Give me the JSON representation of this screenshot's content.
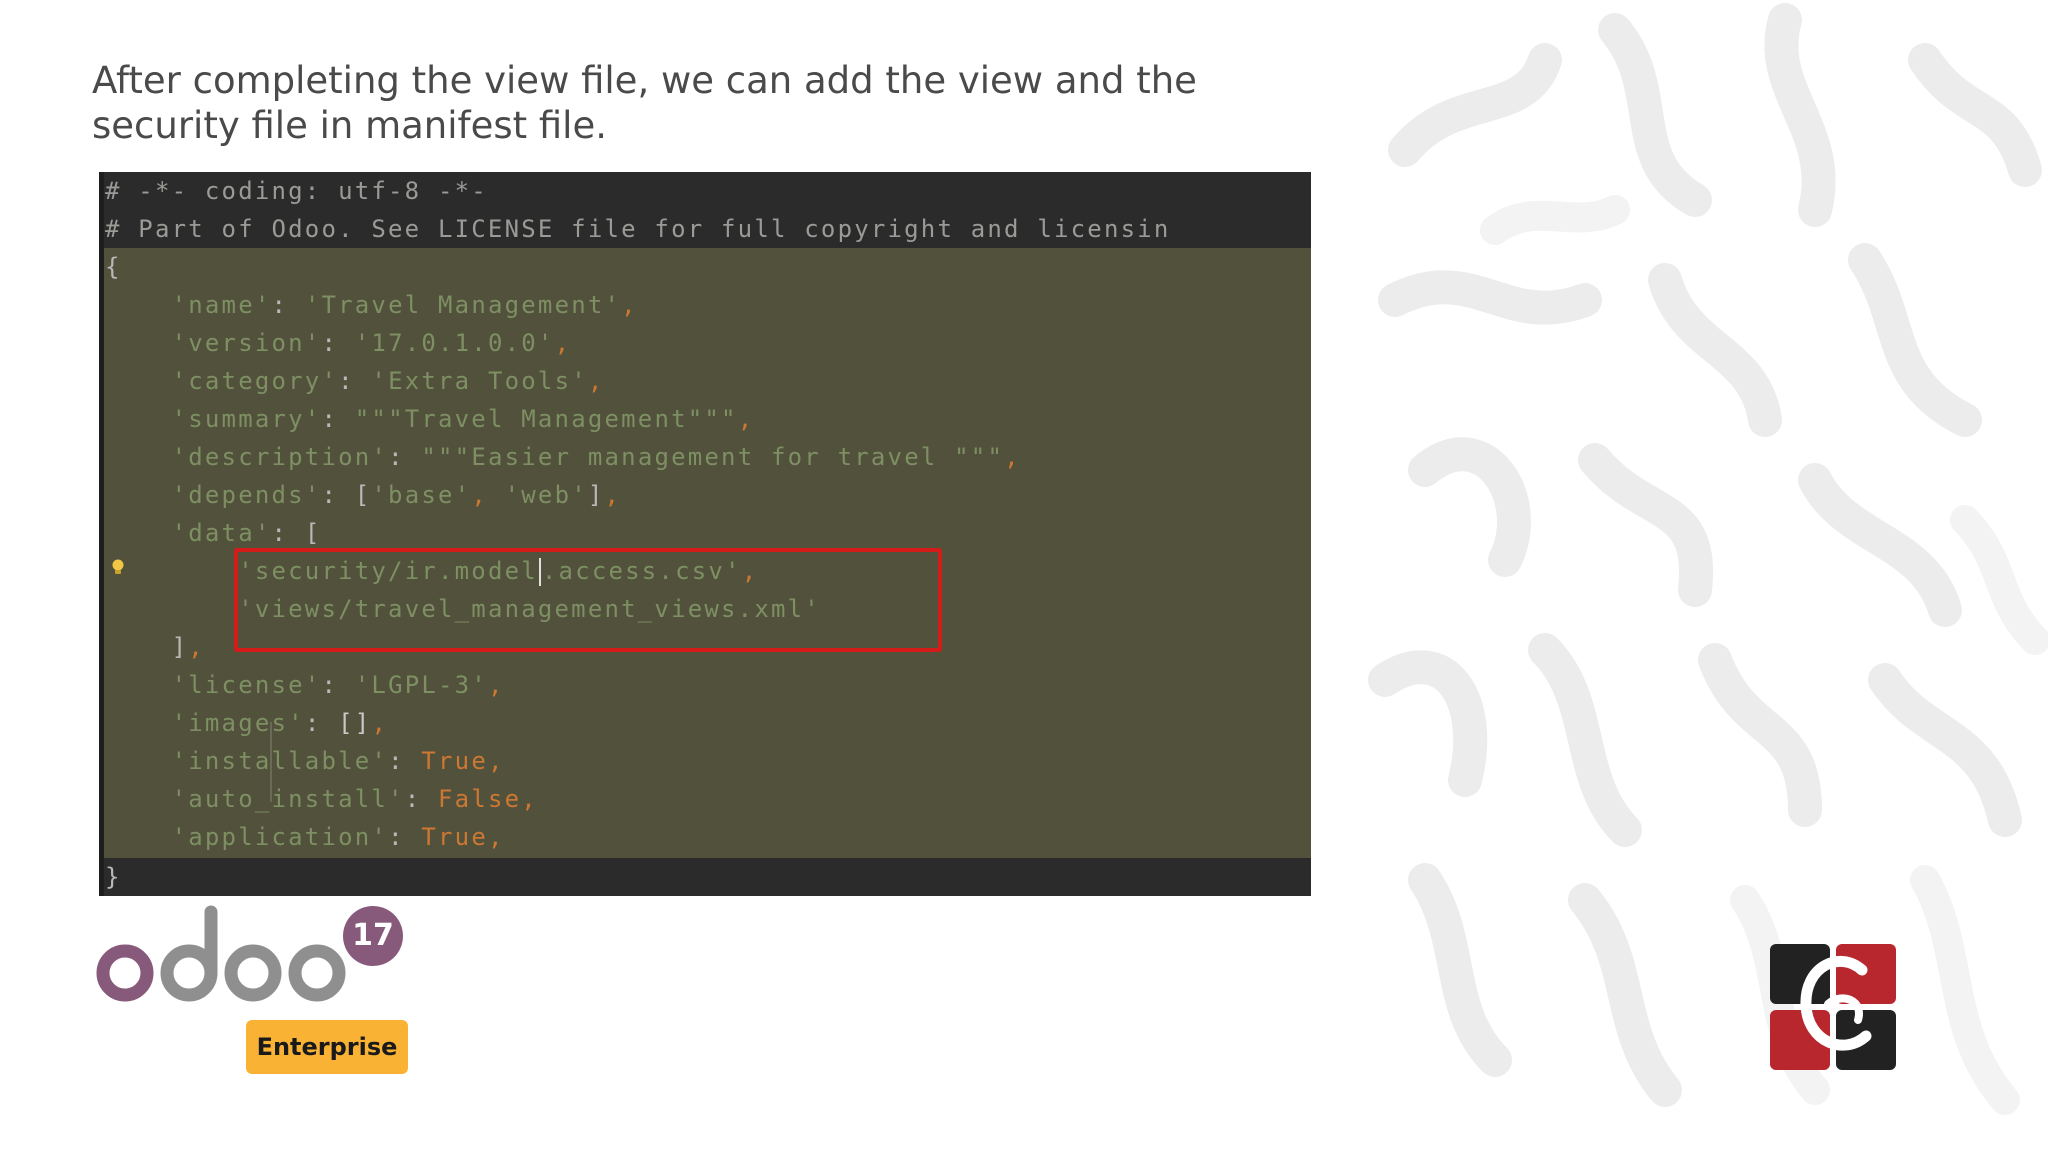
{
  "slide": {
    "heading": "After completing the view file, we can add the view and the security file in manifest file."
  },
  "code": {
    "line_comment_1": "# -*- coding: utf-8 -*-",
    "line_comment_2": "# Part of Odoo. See LICENSE file for full copyright and licensin",
    "open_brace": "{",
    "name_key": "'name'",
    "name_val": "'Travel Management'",
    "version_key": "'version'",
    "version_val": "'17.0.1.0.0'",
    "category_key": "'category'",
    "category_val": "'Extra Tools'",
    "summary_key": "'summary'",
    "summary_val": "\"\"\"Travel Management\"\"\"",
    "description_key": "'description'",
    "description_val": "\"\"\"Easier management for travel \"\"\"",
    "depends_key": "'depends'",
    "depends_v1": "'base'",
    "depends_v2": "'web'",
    "data_key": "'data'",
    "data_item_1a": "'security/ir.model",
    "data_item_1b": ".access.csv'",
    "data_item_2": "'views/travel_management_views.xml'",
    "data_close": "]",
    "license_key": "'license'",
    "license_val": "'LGPL-3'",
    "images_key": "'images'",
    "images_val": "[]",
    "installable_key": "'installable'",
    "installable_val": "True",
    "auto_install_key": "'auto_install'",
    "auto_install_val": "False",
    "application_key": "'application'",
    "application_val": "True",
    "close_brace": "}"
  },
  "branding": {
    "odoo_logo_text": "odoo",
    "version_badge": "17",
    "edition_label": "Enterprise",
    "company_logo_letters": "CY"
  },
  "colors": {
    "code_background": "#52513c",
    "highlight_border": "#d51a1a",
    "odoo_purple": "#875a7b",
    "odoo_gray": "#8f8f8f",
    "enterprise_badge": "#f9b234",
    "company_red": "#b8272d",
    "company_dark": "#222222"
  }
}
